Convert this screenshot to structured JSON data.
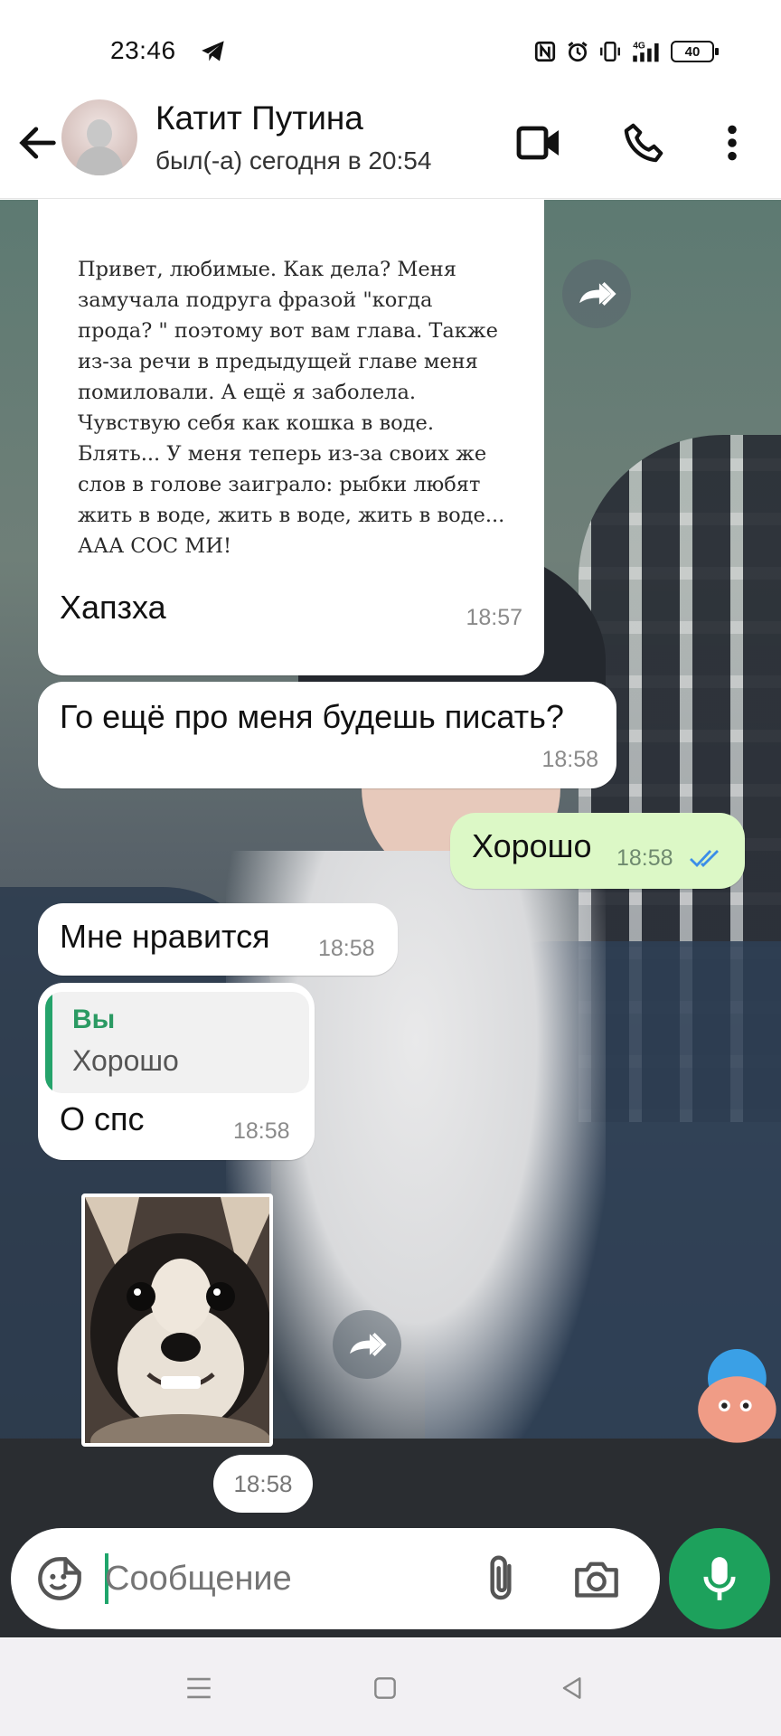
{
  "status_bar": {
    "time": "23:46",
    "battery": "40",
    "icons": [
      "telegram-icon",
      "nfc-icon",
      "alarm-icon",
      "vibrate-icon",
      "signal-4g-icon",
      "battery-icon"
    ]
  },
  "header": {
    "contact_name": "Катит Путина",
    "contact_status": "был(-а) сегодня в 20:54",
    "icons": [
      "back-arrow-icon",
      "video-call-icon",
      "phone-icon",
      "more-vert-icon"
    ]
  },
  "messages": [
    {
      "direction": "in",
      "type": "image-with-caption",
      "image_text": "Привет, любимые. Как дела? Меня замучала подруга фразой \"когда прода? \" поэтому вот вам глава. Также из-за речи в предыдущей главе меня помиловали. А ещё я заболела. Чувствую себя как кошка в воде. Блять... У меня теперь из-за своих же слов в голове заиграло: рыбки любят жить в воде, жить в воде, жить в воде... ААА СОС МИ!",
      "caption": "Хапзха",
      "time": "18:57"
    },
    {
      "direction": "in",
      "type": "text",
      "text": "Го ещё про меня будешь писать?",
      "time": "18:58"
    },
    {
      "direction": "out",
      "type": "text",
      "text": "Хорошо",
      "time": "18:58",
      "status": "read"
    },
    {
      "direction": "in",
      "type": "text",
      "text": "Мне нравится",
      "time": "18:58"
    },
    {
      "direction": "in",
      "type": "reply",
      "quote_author": "Вы",
      "quote_text": "Хорошо",
      "text": "О спс",
      "time": "18:58"
    },
    {
      "direction": "in",
      "type": "sticker-image",
      "subject": "chihuahua",
      "time": "18:58"
    }
  ],
  "composer": {
    "placeholder": "Сообщение",
    "icons": [
      "sticker-icon",
      "attach-icon",
      "camera-icon",
      "mic-icon"
    ]
  },
  "colors": {
    "accent": "#1da15c",
    "outgoing_bubble": "#dcf8c6",
    "incoming_bubble": "#ffffff",
    "read_ticks": "#3b8ee8"
  }
}
